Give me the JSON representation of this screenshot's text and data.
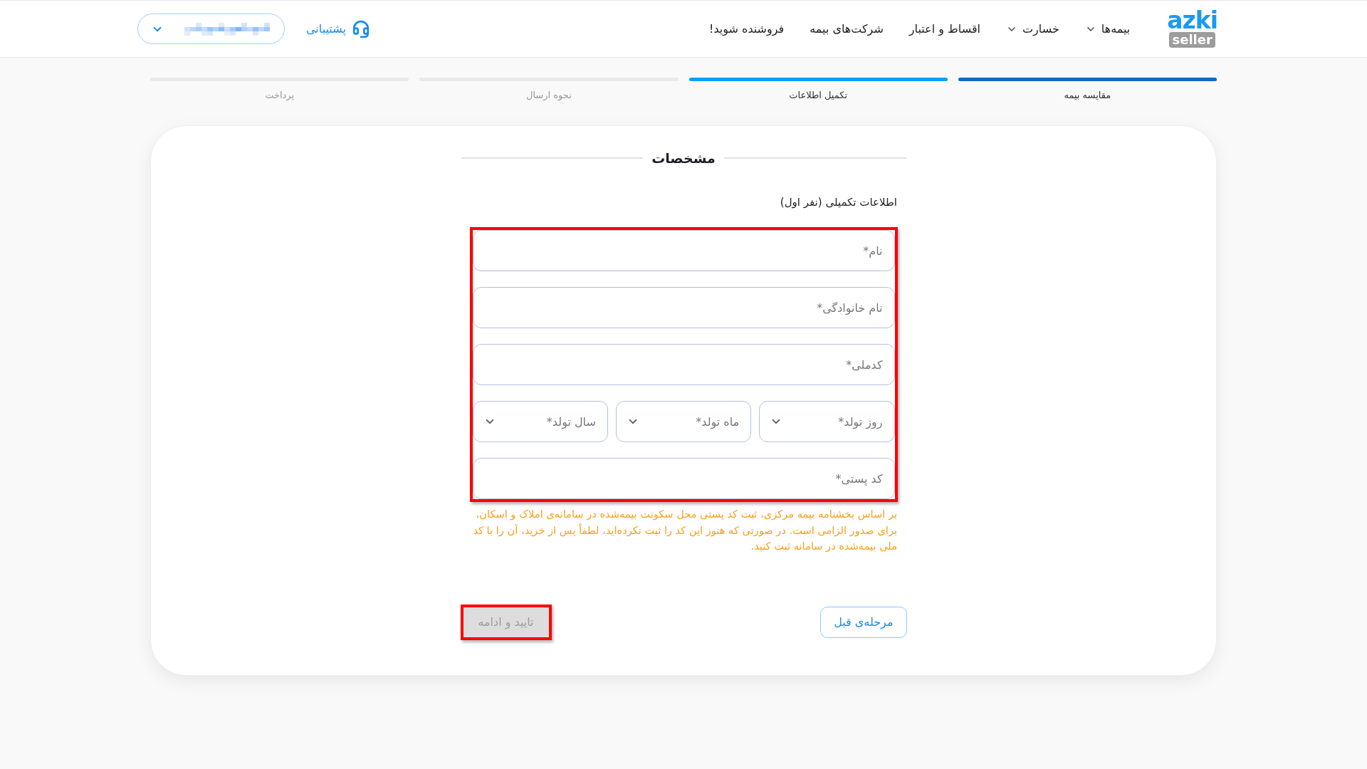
{
  "header": {
    "logo": {
      "wordmark": "azki",
      "tag": "seller"
    },
    "nav": [
      {
        "label": "بیمه‌ها",
        "dropdown": true
      },
      {
        "label": "خسارت",
        "dropdown": true
      },
      {
        "label": "اقساط و اعتبار",
        "dropdown": false
      },
      {
        "label": "شرکت‌های بیمه",
        "dropdown": false
      },
      {
        "label": "فروشنده شوید!",
        "dropdown": false
      }
    ],
    "support": {
      "label": "پشتیبانی"
    }
  },
  "steps": [
    {
      "label": "مقایسه بیمه",
      "completed": true,
      "selected": false
    },
    {
      "label": "تکمیل اطلاعات",
      "completed": false,
      "selected": true
    },
    {
      "label": "نحوه ارسال",
      "completed": false,
      "selected": false
    },
    {
      "label": "پرداخت",
      "completed": false,
      "selected": false
    }
  ],
  "form": {
    "title": "مشخصات",
    "subtitle": "اطلاعات تکمیلی (نفر اول)",
    "highlighted": true,
    "fields": [
      {
        "kind": "text",
        "placeholder": "نام*"
      },
      {
        "kind": "text",
        "placeholder": "نام خانوادگی*"
      },
      {
        "kind": "text",
        "placeholder": "کدملی*"
      },
      {
        "kind": "select_group",
        "selects": [
          {
            "placeholder": "روز تولد*"
          },
          {
            "placeholder": "ماه تولد*"
          },
          {
            "placeholder": "سال تولد*"
          }
        ]
      },
      {
        "kind": "text",
        "placeholder": "کد پستی*"
      }
    ],
    "note": "بر اساس بخشنامه بیمه مرکزی، ثبت کد پستی محل سکونت بیمه‌شده در سامانه‌ی املاک و اسکان، برای صدور الزامی است. در صورتی که هنوز این کد را ثبت نکرده‌اید، لطفاً پس از خرید، آن را با کد ملی بیمه‌شده در سامانه ثبت کنید."
  },
  "buttons": [
    {
      "label": "مرحله‌ی قبل",
      "kind": "outline",
      "disabled": false,
      "highlighted": false
    },
    {
      "label": "تایید و ادامه",
      "kind": "filled",
      "disabled": true,
      "highlighted": true
    }
  ]
}
